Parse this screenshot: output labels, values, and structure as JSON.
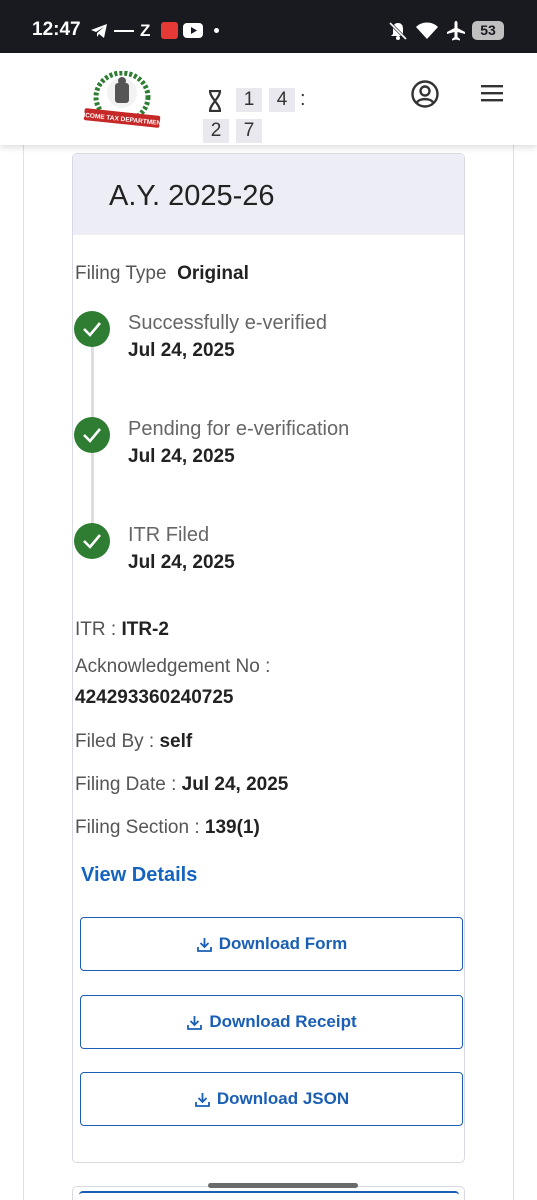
{
  "status_bar": {
    "time": "12:47",
    "z_label": "Z",
    "battery": "53"
  },
  "header": {
    "logo_text": "INCOME TAX DEPARTMENT",
    "timer": {
      "d1": "1",
      "d2": "4",
      "colon": ":",
      "d3": "2",
      "d4": "7"
    }
  },
  "card": {
    "assessment_year": "A.Y. 2025-26",
    "filing_type_label": "Filing Type",
    "filing_type_value": "Original",
    "timeline": [
      {
        "title": "Successfully e-verified",
        "date": "Jul 24, 2025"
      },
      {
        "title": "Pending for e-verification",
        "date": "Jul 24, 2025"
      },
      {
        "title": "ITR Filed",
        "date": "Jul 24, 2025"
      }
    ],
    "itr_label": "ITR : ",
    "itr_value": "ITR-2",
    "ack_label": "Acknowledgement No :",
    "ack_value": "424293360240725",
    "filed_by_label": "Filed By : ",
    "filed_by_value": "self",
    "filing_date_label": "Filing Date : ",
    "filing_date_value": "Jul 24, 2025",
    "filing_section_label": "Filing Section : ",
    "filing_section_value": "139(1)",
    "view_details": "View Details",
    "buttons": {
      "download_form": "Download Form",
      "download_receipt": "Download Receipt",
      "download_json": "Download JSON"
    }
  },
  "colors": {
    "accent": "#1a5fb4",
    "success": "#2e7d32",
    "card_header_bg": "#edeef5"
  }
}
